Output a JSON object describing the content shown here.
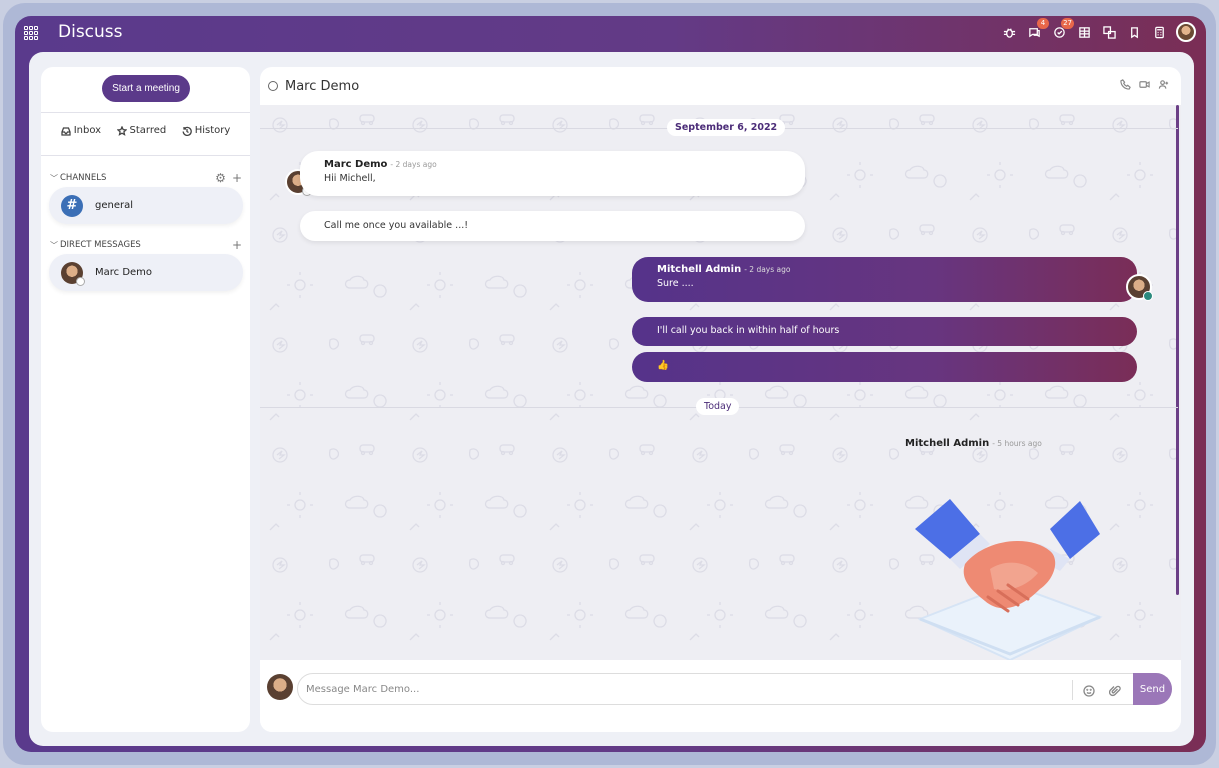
{
  "app": {
    "title": "Discuss"
  },
  "topbar": {
    "icons": [
      {
        "name": "bug-icon",
        "badge": ""
      },
      {
        "name": "messages-icon",
        "badge": "4"
      },
      {
        "name": "activity-icon",
        "badge": "27"
      },
      {
        "name": "grid-icon",
        "badge": ""
      },
      {
        "name": "language-icon",
        "badge": ""
      },
      {
        "name": "bookmark-icon",
        "badge": ""
      },
      {
        "name": "calculator-icon",
        "badge": ""
      }
    ]
  },
  "sidebar": {
    "start_meeting": "Start a meeting",
    "mailboxes": [
      {
        "label": "Inbox",
        "icon": "inbox-icon"
      },
      {
        "label": "Starred",
        "icon": "star-icon"
      },
      {
        "label": "History",
        "icon": "history-icon"
      }
    ],
    "channels_header": "CHANNELS",
    "channels": [
      {
        "label": "general"
      }
    ],
    "dm_header": "DIRECT MESSAGES",
    "direct_messages": [
      {
        "label": "Marc Demo"
      }
    ]
  },
  "thread": {
    "name": "Marc Demo",
    "dates": {
      "first": "September 6, 2022",
      "second": "Today"
    },
    "messages": [
      {
        "author": "Marc Demo",
        "time": "- 2 days ago",
        "body": "Hii Michell,"
      },
      {
        "author": "",
        "time": "",
        "body": "Call me once you available ...!"
      },
      {
        "author": "Mitchell Admin",
        "time": "- 2 days ago",
        "body": "Sure ...."
      },
      {
        "author": "",
        "time": "",
        "body": "I'll call you back in within half of hours"
      },
      {
        "author": "",
        "time": "",
        "body": "👍"
      },
      {
        "author": "Mitchell Admin",
        "time": "- 5 hours ago",
        "body": ""
      }
    ]
  },
  "composer": {
    "placeholder": "Message Marc Demo...",
    "send_label": "Send"
  },
  "colors": {
    "brand": "#5b3a8a",
    "accent_end": "#7a2d57",
    "badge": "#e8674a",
    "channel_icon": "#3b6fb6"
  }
}
